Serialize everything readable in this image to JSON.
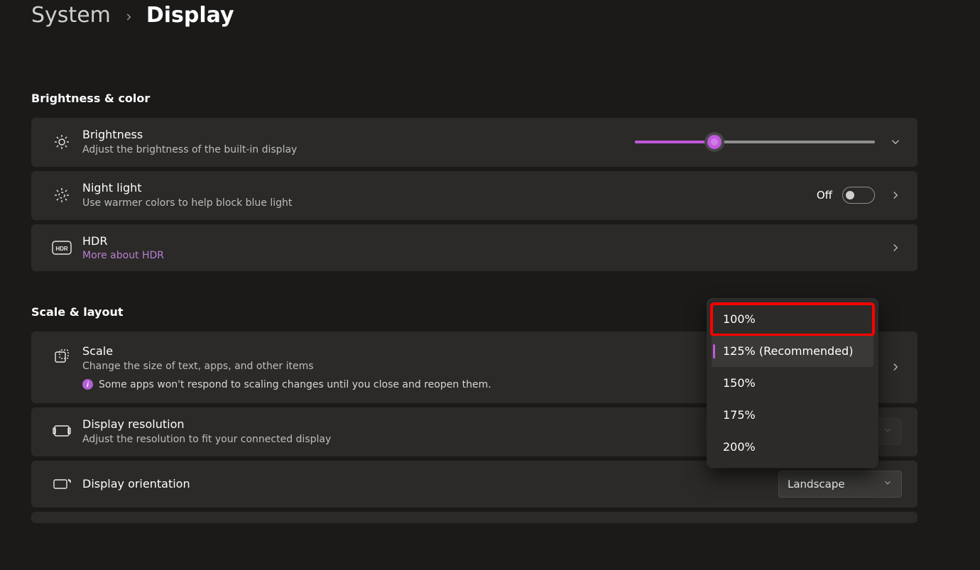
{
  "breadcrumb": {
    "parent": "System",
    "current": "Display"
  },
  "sections": {
    "brightness_color": "Brightness & color",
    "scale_layout": "Scale & layout"
  },
  "brightness": {
    "title": "Brightness",
    "subtitle": "Adjust the brightness of the built-in display",
    "value_percent": 33
  },
  "night_light": {
    "title": "Night light",
    "subtitle": "Use warmer colors to help block blue light",
    "state_label": "Off",
    "on": false
  },
  "hdr": {
    "title": "HDR",
    "link": "More about HDR"
  },
  "scale": {
    "title": "Scale",
    "subtitle": "Change the size of text, apps, and other items",
    "info": "Some apps won't respond to scaling changes until you close and reopen them.",
    "options": [
      "100%",
      "125% (Recommended)",
      "150%",
      "175%",
      "200%"
    ],
    "selected_index": 1,
    "highlighted_index": 0
  },
  "resolution": {
    "title": "Display resolution",
    "subtitle": "Adjust the resolution to fit your connected display"
  },
  "orientation": {
    "title": "Display orientation",
    "value": "Landscape"
  }
}
